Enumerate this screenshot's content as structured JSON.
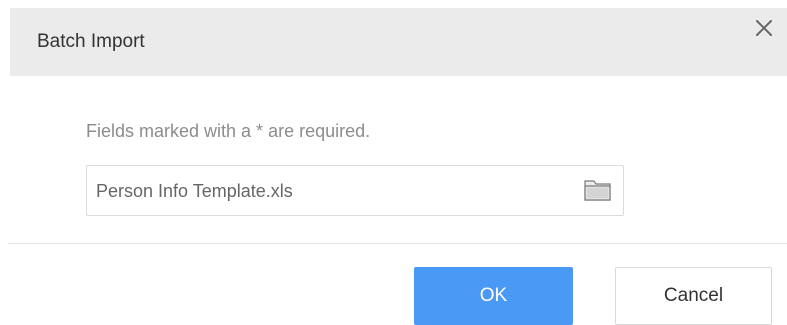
{
  "dialog": {
    "title": "Batch Import",
    "close_icon": "close-icon",
    "hint": "Fields marked with a * are required.",
    "file_field": {
      "value": "Person Info Template.xls",
      "icon": "folder-icon"
    },
    "buttons": {
      "ok_label": "OK",
      "cancel_label": "Cancel"
    }
  },
  "colors": {
    "header_bg": "#ebebeb",
    "primary": "#4a9af5",
    "hint_text": "#8c8c8c",
    "border": "#dcdcdc"
  }
}
